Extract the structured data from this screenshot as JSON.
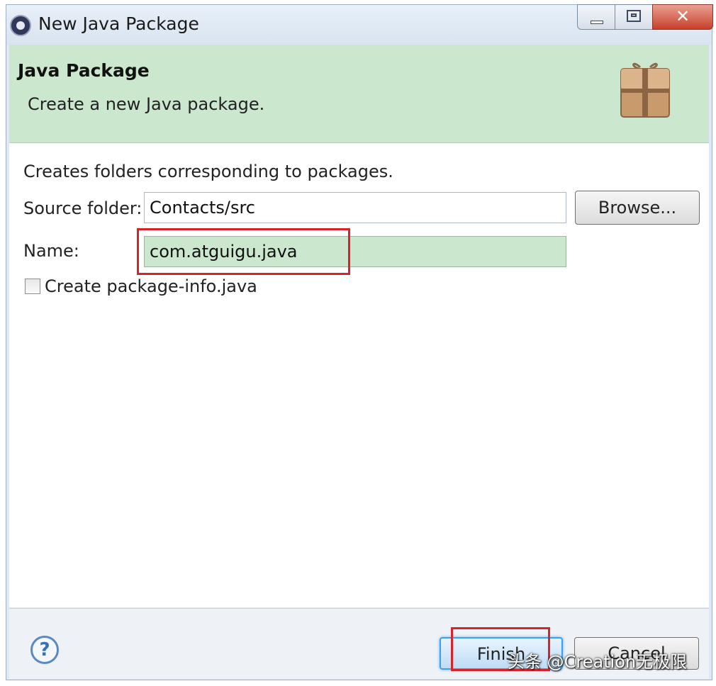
{
  "window": {
    "title": "New Java Package",
    "controls": {
      "minimize": "",
      "maximize": "",
      "close": "✕"
    }
  },
  "header": {
    "title": "Java Package",
    "description": "Create a new Java package."
  },
  "form": {
    "intro": "Creates folders corresponding to packages.",
    "source_folder_label": "Source folder:",
    "source_folder_value": "Contacts/src",
    "browse_label": "Browse...",
    "name_label": "Name:",
    "name_value": "com.atguigu.java",
    "create_info_label": "Create package-info.java",
    "create_info_checked": false
  },
  "footer": {
    "help_glyph": "?",
    "finish_label": "Finish",
    "cancel_label": "Cancel"
  },
  "watermark": "头条 @Creation无极限",
  "colors": {
    "header_bg": "#cbe8cf",
    "name_field_bg": "#cbe8cf",
    "highlight": "#d9232b",
    "finish_focus": "#3d9ff0"
  },
  "icons": {
    "app": "eclipse-icon",
    "package": "package-box-icon",
    "help": "help-icon"
  }
}
